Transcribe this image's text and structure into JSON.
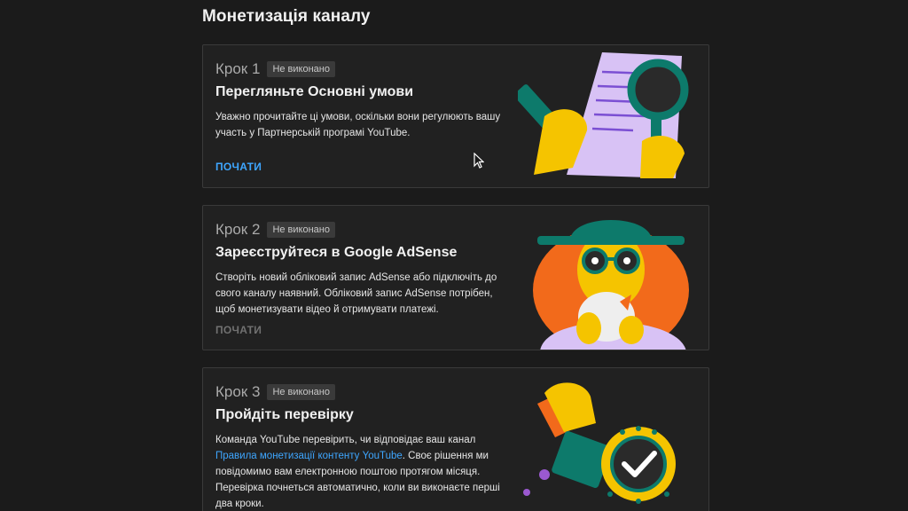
{
  "page": {
    "title": "Монетизація каналу"
  },
  "steps": [
    {
      "step_label": "Крок 1",
      "status": "Не виконано",
      "title": "Перегляньте Основні умови",
      "description": "Уважно прочитайте ці умови, оскільки вони регулюють вашу участь у Партнерській програмі YouTube.",
      "action": "ПОЧАТИ",
      "illustration": "document-magnifier-illustration"
    },
    {
      "step_label": "Крок 2",
      "status": "Не виконано",
      "title": "Зареєструйтеся в Google AdSense",
      "description": "Створіть новий обліковий запис AdSense або підключіть до свого каналу наявний. Обліковий запис AdSense потрібен, щоб монетизувати відео й отримувати платежі.",
      "action": "ПОЧАТИ",
      "illustration": "person-with-glasses-illustration"
    },
    {
      "step_label": "Крок 3",
      "status": "Не виконано",
      "title": "Пройдіть перевірку",
      "description_part1": "Команда YouTube перевірить, чи відповідає ваш канал ",
      "description_link": "Правила монетизації контенту YouTube",
      "description_part2": ". Своє рішення ми повідомимо вам електронною поштою протягом місяця. Перевірка почнеться автоматично, коли ви виконаєте перші два кроки.",
      "illustration": "approval-stamp-illustration"
    }
  ],
  "colors": {
    "background": "#1b1b1b",
    "card": "#212121",
    "link": "#3ea6ff",
    "disabled": "#717171",
    "illustration_yellow": "#f5c400",
    "illustration_teal": "#0d7a6b",
    "illustration_purple": "#d8c2f5",
    "illustration_orange": "#f26a1b"
  }
}
